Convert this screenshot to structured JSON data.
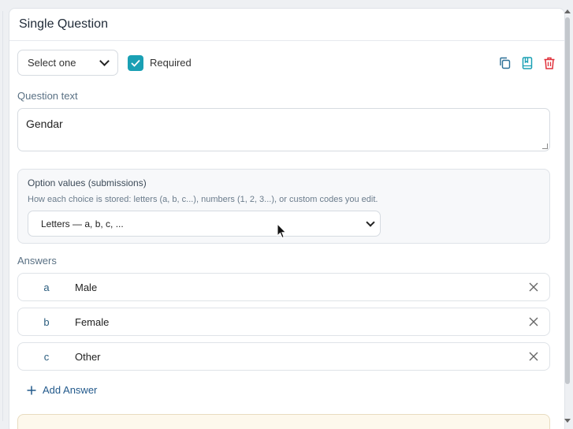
{
  "card": {
    "title": "Single Question"
  },
  "toolbar": {
    "type_select_value": "Select one",
    "required_label": "Required",
    "required_checked": true
  },
  "question": {
    "label": "Question text",
    "text": "Gendar"
  },
  "option_values": {
    "title": "Option values (submissions)",
    "description": "How each choice is stored: letters (a, b, c...), numbers (1, 2, 3...), or custom codes you edit.",
    "selected": "Letters — a, b, c, ..."
  },
  "answers": {
    "label": "Answers",
    "items": [
      {
        "code": "a",
        "text": "Male"
      },
      {
        "code": "b",
        "text": "Female"
      },
      {
        "code": "c",
        "text": "Other"
      }
    ],
    "add_label": "Add Answer"
  },
  "colors": {
    "accent": "#1aa0b4",
    "link": "#235a8c",
    "delete": "#e0303a"
  },
  "icons": [
    "copy-icon",
    "bookmark-icon",
    "trash-icon",
    "close-icon",
    "plus-icon",
    "check-icon",
    "chevron-down-icon"
  ]
}
